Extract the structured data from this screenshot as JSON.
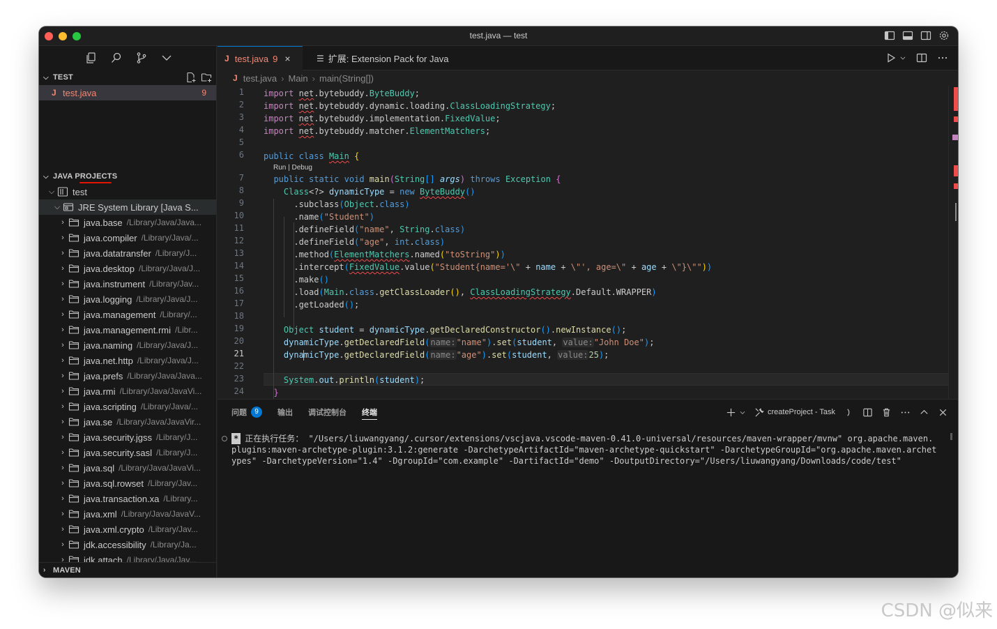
{
  "window": {
    "title": "test.java — test"
  },
  "sidebar": {
    "section_test": "TEST",
    "file": {
      "name": "test.java",
      "badge": "9"
    },
    "section_java_projects": "JAVA PROJECTS",
    "section_maven": "MAVEN",
    "project_name": "test",
    "jre": {
      "name": "JRE System Library [Java S..."
    },
    "modules": [
      {
        "name": "java.base",
        "desc": "/Library/Java/Java..."
      },
      {
        "name": "java.compiler",
        "desc": "/Library/Java/..."
      },
      {
        "name": "java.datatransfer",
        "desc": "/Library/J..."
      },
      {
        "name": "java.desktop",
        "desc": "/Library/Java/J..."
      },
      {
        "name": "java.instrument",
        "desc": "/Library/Jav..."
      },
      {
        "name": "java.logging",
        "desc": "/Library/Java/J..."
      },
      {
        "name": "java.management",
        "desc": "/Library/..."
      },
      {
        "name": "java.management.rmi",
        "desc": "/Libr..."
      },
      {
        "name": "java.naming",
        "desc": "/Library/Java/J..."
      },
      {
        "name": "java.net.http",
        "desc": "/Library/Java/J..."
      },
      {
        "name": "java.prefs",
        "desc": "/Library/Java/Java..."
      },
      {
        "name": "java.rmi",
        "desc": "/Library/Java/JavaVi..."
      },
      {
        "name": "java.scripting",
        "desc": "/Library/Java/..."
      },
      {
        "name": "java.se",
        "desc": "/Library/Java/JavaVir..."
      },
      {
        "name": "java.security.jgss",
        "desc": "/Library/J..."
      },
      {
        "name": "java.security.sasl",
        "desc": "/Library/J..."
      },
      {
        "name": "java.sql",
        "desc": "/Library/Java/JavaVi..."
      },
      {
        "name": "java.sql.rowset",
        "desc": "/Library/Jav..."
      },
      {
        "name": "java.transaction.xa",
        "desc": "/Library..."
      },
      {
        "name": "java.xml",
        "desc": "/Library/Java/JavaV..."
      },
      {
        "name": "java.xml.crypto",
        "desc": "/Library/Jav..."
      },
      {
        "name": "jdk.accessibility",
        "desc": "/Library/Ja..."
      },
      {
        "name": "jdk.attach",
        "desc": "/Library/Java/Jav..."
      }
    ]
  },
  "tabs": [
    {
      "label": "test.java",
      "count": "9",
      "close": "×"
    },
    {
      "label": "扩展: Extension Pack for Java"
    }
  ],
  "breadcrumb": [
    "test.java",
    "Main",
    "main(String[])"
  ],
  "editor": {
    "line_numbers": [
      "1",
      "2",
      "3",
      "4",
      "5",
      "6",
      "7",
      "8",
      "9",
      "10",
      "11",
      "12",
      "13",
      "14",
      "15",
      "16",
      "17",
      "18",
      "19",
      "20",
      "21",
      "22",
      "23",
      "24"
    ],
    "current_line": "21",
    "codelens": "Run | Debug"
  },
  "panel": {
    "tabs": [
      {
        "label": "问题",
        "badge": "9"
      },
      {
        "label": "输出"
      },
      {
        "label": "调试控制台"
      },
      {
        "label": "终端"
      }
    ],
    "task": "createProject - Task",
    "terminal_star": "*",
    "terminal_text": "正在执行任务： \"/Users/liuwangyang/.cursor/extensions/vscjava.vscode-maven-0.41.0-universal/resources/maven-wrapper/mvnw\" org.apache.maven.plugins:maven-archetype-plugin:3.1.2:generate -DarchetypeArtifactId=\"maven-archetype-quickstart\" -DarchetypeGroupId=\"org.apache.maven.archetypes\" -DarchetypeVersion=\"1.4\" -DgroupId=\"com.example\" -DartifactId=\"demo\" -DoutputDirectory=\"/Users/liuwangyang/Downloads/code/test\""
  },
  "watermark": "CSDN @似来"
}
